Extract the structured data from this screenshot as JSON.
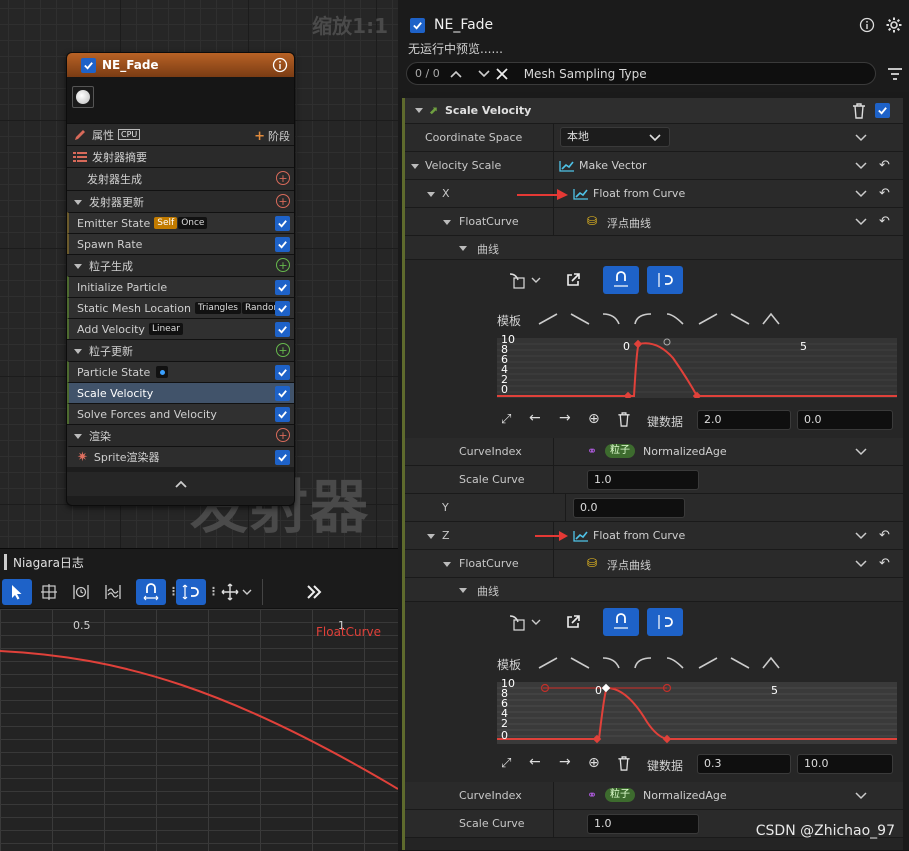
{
  "graph": {
    "zoom_label": "缩放1:1",
    "watermark": "发射器",
    "node": {
      "title": "NE_Fade",
      "properties_label": "属性",
      "cpu_badge": "CPU",
      "stage_label": "阶段",
      "summary_label": "发射器摘要",
      "sections": [
        {
          "label": "发射器生成"
        },
        {
          "label": "发射器更新"
        },
        {
          "label": "粒子生成"
        },
        {
          "label": "粒子更新"
        },
        {
          "label": "渲染"
        }
      ],
      "modules": {
        "emitter_state": {
          "label": "Emitter State",
          "tags": [
            "Self",
            "Once"
          ]
        },
        "spawn_rate": {
          "label": "Spawn Rate"
        },
        "initialize_particle": {
          "label": "Initialize Particle"
        },
        "static_mesh_location": {
          "label": "Static Mesh Location",
          "tags": [
            "Triangles",
            "Random"
          ]
        },
        "add_velocity": {
          "label": "Add Velocity",
          "tags": [
            "Linear"
          ]
        },
        "particle_state": {
          "label": "Particle State"
        },
        "scale_velocity": {
          "label": "Scale Velocity"
        },
        "solve_forces": {
          "label": "Solve Forces and Velocity"
        },
        "sprite_renderer": {
          "label": "Sprite渲染器"
        }
      }
    }
  },
  "log": {
    "tab_label": "Niagara日志",
    "tick_05": "0.5",
    "tick_1": "1",
    "curve_label": "FloatCurve"
  },
  "details": {
    "title": "NE_Fade",
    "subtitle": "无运行中预览......",
    "search": {
      "counter": "0 / 0",
      "text": "Mesh Sampling Type"
    },
    "module_title": "Scale Velocity",
    "coordinate_space": {
      "label": "Coordinate Space",
      "value": "本地"
    },
    "velocity_scale": {
      "label": "Velocity Scale",
      "value": "Make Vector"
    },
    "x": {
      "label": "X",
      "value": "Float from Curve",
      "floatcurve_label": "FloatCurve",
      "floatcurve_value": "浮点曲线",
      "curve_label": "曲线",
      "template_label": "模板",
      "key_label": "键数据",
      "key_time": "2.0",
      "key_value": "0.0",
      "y_ticks": [
        "10",
        "8",
        "6",
        "4",
        "2",
        "0"
      ],
      "x_ticks": [
        "0",
        "5"
      ],
      "curveindex_label": "CurveIndex",
      "curveindex_badge": "粒子",
      "curveindex_value": "NormalizedAge",
      "scalecurve_label": "Scale Curve",
      "scalecurve_value": "1.0"
    },
    "y": {
      "label": "Y",
      "value": "0.0"
    },
    "z": {
      "label": "Z",
      "value": "Float from Curve",
      "floatcurve_label": "FloatCurve",
      "floatcurve_value": "浮点曲线",
      "curve_label": "曲线",
      "template_label": "模板",
      "key_label": "键数据",
      "key_time": "0.3",
      "key_value": "10.0",
      "y_ticks": [
        "10",
        "8",
        "6",
        "4",
        "2",
        "0"
      ],
      "x_ticks": [
        "0",
        "5"
      ],
      "curveindex_label": "CurveIndex",
      "curveindex_badge": "粒子",
      "curveindex_value": "NormalizedAge",
      "scalecurve_label": "Scale Curve",
      "scalecurve_value": "1.0"
    }
  },
  "watermark_credit": "CSDN @Zhichao_97",
  "colors": {
    "accent_blue": "#1e62c8",
    "curve_red": "#e0413a",
    "arrow_red": "#e53935",
    "node_header": "#b86225"
  }
}
